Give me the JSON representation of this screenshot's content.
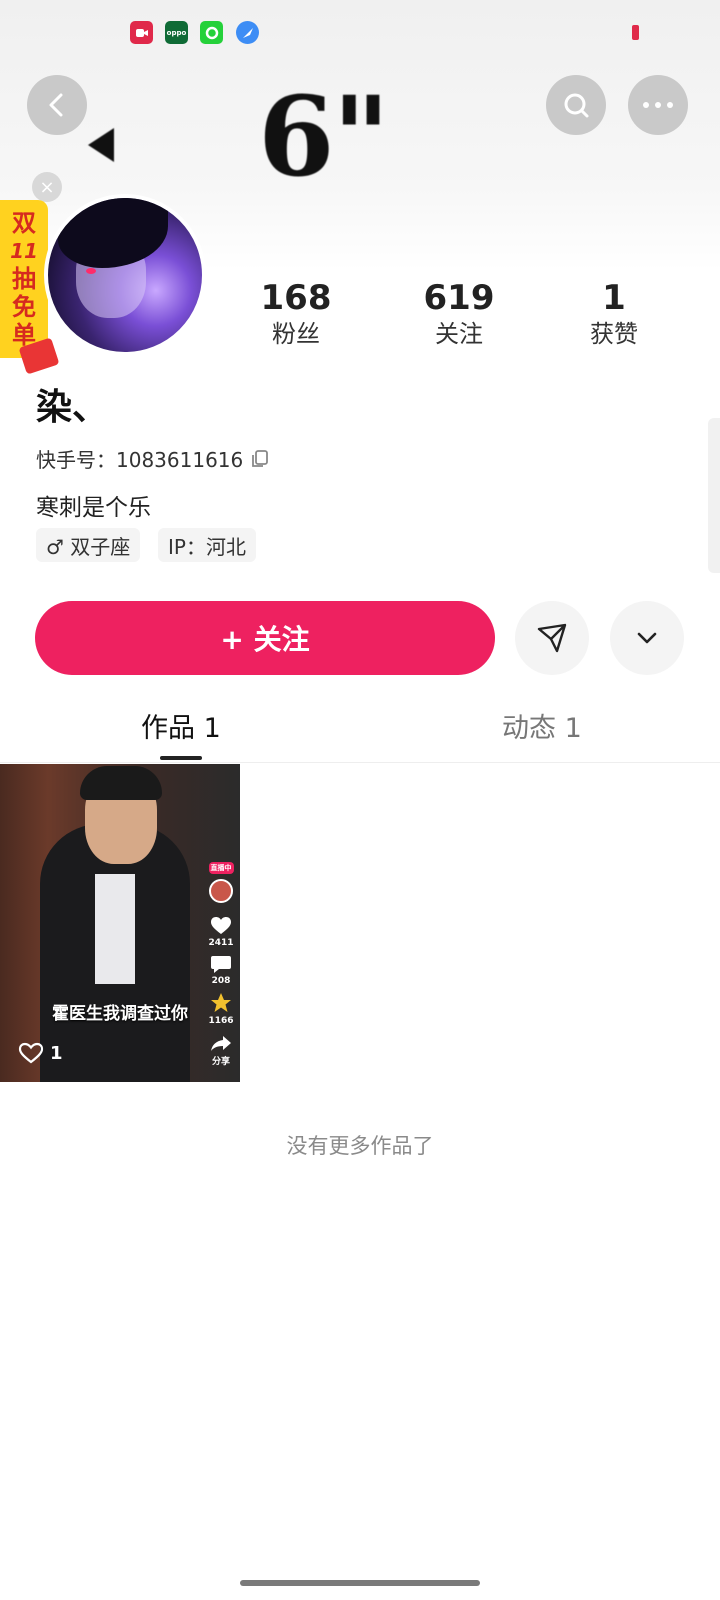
{
  "header": {
    "cover_text": "6\"",
    "back_icon": "chevron-left-icon",
    "search_icon": "search-icon",
    "more_icon": "more-dots-icon"
  },
  "status_bar": {
    "apps": [
      "video-app-icon",
      "oppo-app-icon",
      "green-app-icon",
      "browser-app-icon"
    ],
    "oppo_text": "oppo"
  },
  "promo": {
    "chars": [
      "双",
      "11",
      "抽",
      "免",
      "单"
    ],
    "close_symbol": "×"
  },
  "profile": {
    "name": "染、",
    "id_label": "快手号：1083611616",
    "bio": "寒刺是个乐",
    "tags": [
      "♂ 双子座",
      "IP：河北"
    ]
  },
  "stats": [
    {
      "value": "168",
      "label": "粉丝"
    },
    {
      "value": "619",
      "label": "关注"
    },
    {
      "value": "1",
      "label": "获赞"
    }
  ],
  "actions": {
    "follow_label": "+ 关注",
    "share_icon": "send-icon",
    "dropdown_icon": "chevron-down-icon"
  },
  "tabs": [
    {
      "label": "作品 1",
      "active": true
    },
    {
      "label": "动态 1",
      "active": false
    }
  ],
  "videos": [
    {
      "caption": "霍医生我调查过你",
      "likes": "1",
      "side_counts": [
        "2411",
        "208",
        "1166",
        "分享"
      ],
      "live_badge": "直播中"
    }
  ],
  "footer": {
    "no_more": "没有更多作品了"
  },
  "colors": {
    "accent": "#ee2160",
    "promo_bg": "#ffd21f",
    "promo_text": "#d62a1f"
  }
}
